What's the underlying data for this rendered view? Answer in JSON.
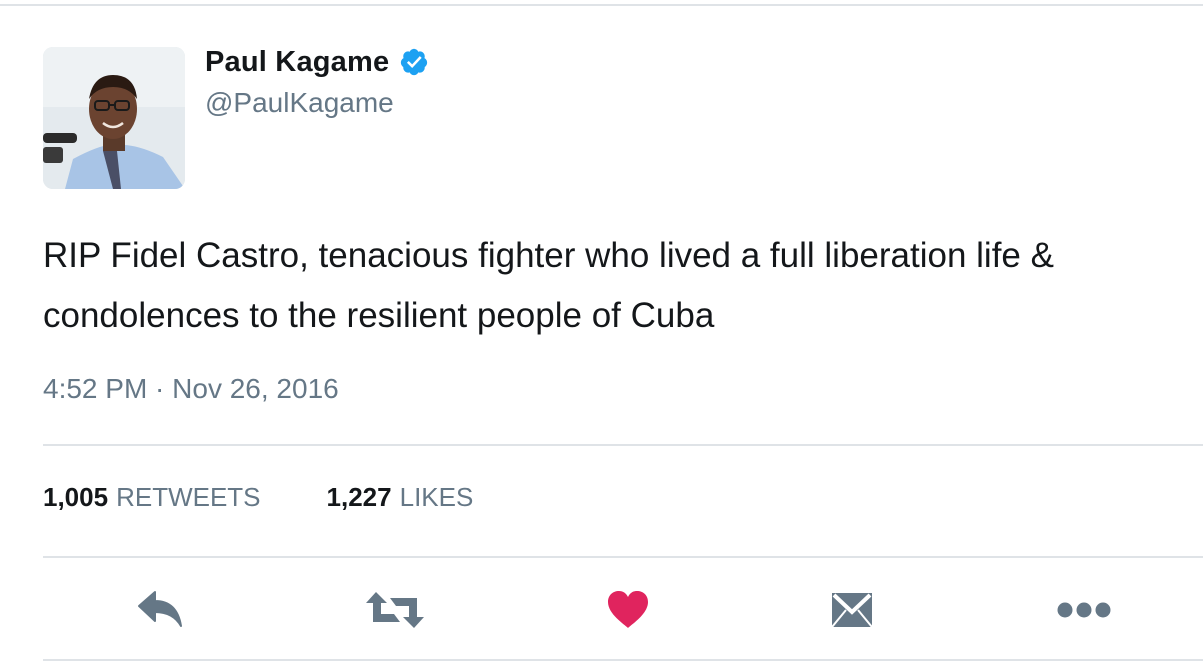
{
  "user": {
    "display_name": "Paul Kagame",
    "handle": "@PaulKagame",
    "verified": true
  },
  "tweet": {
    "text": "RIP Fidel Castro, tenacious fighter who lived a full liberation life &\ncondolences to the resilient people of Cuba",
    "timestamp": "4:52 PM · Nov 26, 2016"
  },
  "stats": {
    "retweets_count": "1,005",
    "retweets_label": "RETWEETS",
    "likes_count": "1,227",
    "likes_label": "LIKES"
  },
  "actions": {
    "reply": "reply-icon",
    "retweet": "retweet-icon",
    "like": "heart-icon",
    "direct_message": "envelope-icon",
    "more": "more-dots-icon"
  },
  "colors": {
    "text_primary": "#14171a",
    "text_secondary": "#657786",
    "verified_blue": "#1da1f2",
    "like_red": "#e0245e",
    "icon_gray": "#657786",
    "divider": "#dfe3e7"
  }
}
